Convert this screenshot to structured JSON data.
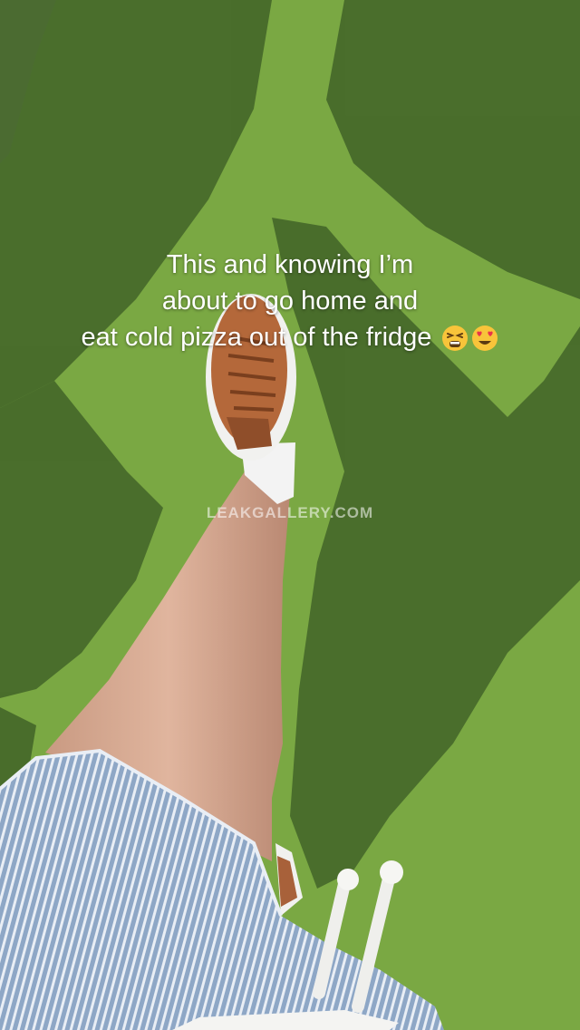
{
  "caption": {
    "lines": [
      "This and knowing I’m",
      "about to go home and",
      "eat cold pizza out of the fridge"
    ],
    "emojis": [
      "tired-face-emoji",
      "heart-eyes-emoji"
    ]
  },
  "watermark": "LEAKGALLERY.COM",
  "colors": {
    "grass": "#7aa843",
    "shadow": "#3f6426",
    "shoe": "#b4683a",
    "shorts": "#7d98b8"
  }
}
